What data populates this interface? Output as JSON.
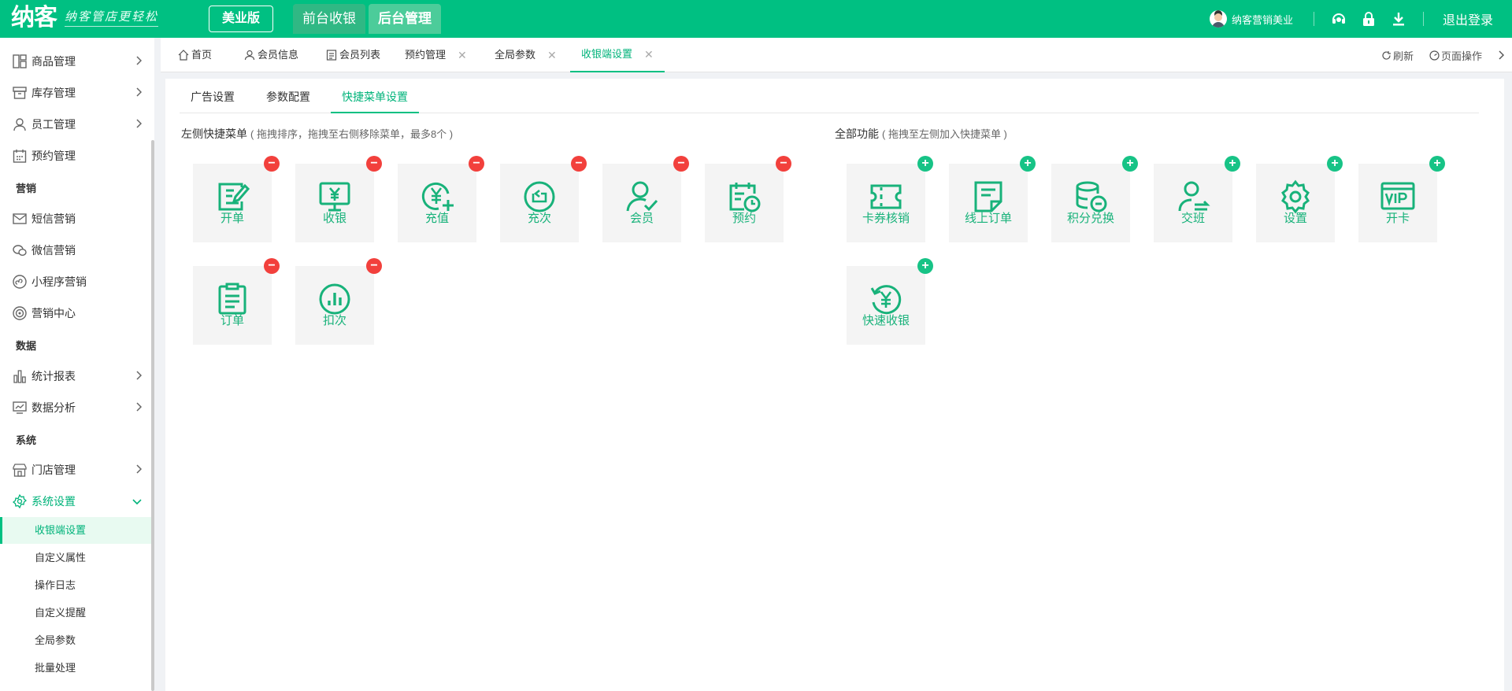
{
  "brand": {
    "logo": "纳客",
    "slogan": "纳客管店更轻松",
    "edition": "美业版"
  },
  "topnav": [
    {
      "label": "前台收银",
      "active": false
    },
    {
      "label": "后台管理",
      "active": true
    }
  ],
  "user": {
    "name": "纳客营销美业"
  },
  "header": {
    "logout": "退出登录"
  },
  "sidebar": {
    "items": [
      {
        "label": "商品管理",
        "icon": "goods-icon",
        "has_arrow": true
      },
      {
        "label": "库存管理",
        "icon": "inventory-icon",
        "has_arrow": true
      },
      {
        "label": "员工管理",
        "icon": "staff-icon",
        "has_arrow": true
      },
      {
        "label": "预约管理",
        "icon": "calendar-icon",
        "has_arrow": false
      }
    ],
    "section_marketing": "营销",
    "marketing": [
      {
        "label": "短信营销",
        "icon": "mail-icon"
      },
      {
        "label": "微信营销",
        "icon": "wechat-icon"
      },
      {
        "label": "小程序营销",
        "icon": "miniapp-icon"
      },
      {
        "label": "营销中心",
        "icon": "target-icon"
      }
    ],
    "section_data": "数据",
    "data": [
      {
        "label": "统计报表",
        "icon": "bar-chart-icon"
      },
      {
        "label": "数据分析",
        "icon": "monitor-chart-icon"
      }
    ],
    "section_system": "系统",
    "system": [
      {
        "label": "门店管理",
        "icon": "store-icon"
      },
      {
        "label": "系统设置",
        "icon": "settings-icon"
      }
    ],
    "system_sub": [
      "收银端设置",
      "自定义属性",
      "操作日志",
      "自定义提醒",
      "全局参数",
      "批量处理"
    ]
  },
  "tabs": [
    {
      "label": "首页",
      "closable": false
    },
    {
      "label": "会员信息",
      "closable": false
    },
    {
      "label": "会员列表",
      "closable": false
    },
    {
      "label": "预约管理",
      "closable": true
    },
    {
      "label": "全局参数",
      "closable": true
    },
    {
      "label": "收银端设置",
      "closable": true,
      "active": true
    }
  ],
  "tab_actions": {
    "refresh": "刷新",
    "page_ops": "页面操作"
  },
  "subtabs": [
    "广告设置",
    "参数配置",
    "快捷菜单设置"
  ],
  "left_panel": {
    "title": "左侧快捷菜单",
    "hint": "( 拖拽排序，拖拽至右侧移除菜单，最多8个 )",
    "items": [
      {
        "label": "开单",
        "icon": "open-order-icon"
      },
      {
        "label": "收银",
        "icon": "cashier-icon"
      },
      {
        "label": "充值",
        "icon": "recharge-icon"
      },
      {
        "label": "充次",
        "icon": "recharge-times-icon"
      },
      {
        "label": "会员",
        "icon": "member-icon"
      },
      {
        "label": "预约",
        "icon": "appointment-icon"
      },
      {
        "label": "订单",
        "icon": "order-icon"
      },
      {
        "label": "扣次",
        "icon": "deduct-times-icon"
      }
    ]
  },
  "right_panel": {
    "title": "全部功能",
    "hint": "( 拖拽至左侧加入快捷菜单 )",
    "items": [
      {
        "label": "卡券核销",
        "icon": "coupon-icon"
      },
      {
        "label": "线上订单",
        "icon": "online-order-icon"
      },
      {
        "label": "积分兑换",
        "icon": "points-icon"
      },
      {
        "label": "交班",
        "icon": "shift-icon"
      },
      {
        "label": "设置",
        "icon": "gear-icon"
      },
      {
        "label": "开卡",
        "icon": "vip-card-icon"
      },
      {
        "label": "快速收银",
        "icon": "quick-cashier-icon"
      }
    ]
  },
  "colors": {
    "brand": "#00c082",
    "icon_green": "#18b27a",
    "remove": "#f2403c",
    "add": "#17c386"
  }
}
